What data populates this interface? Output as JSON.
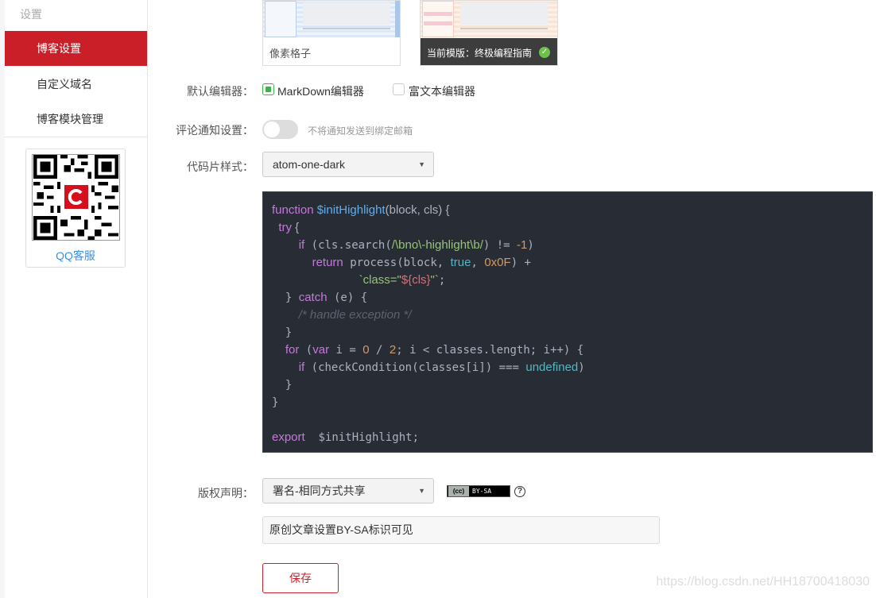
{
  "sidebar": {
    "heading": "设置",
    "items": [
      {
        "label": "博客设置",
        "active": true
      },
      {
        "label": "自定义域名",
        "active": false
      },
      {
        "label": "博客模块管理",
        "active": false
      }
    ],
    "qr": {
      "caption": "QQ客服"
    }
  },
  "templates": [
    {
      "name": "像素格子",
      "current": false
    },
    {
      "name": "当前模版：终极编程指南",
      "current": true
    }
  ],
  "form": {
    "editor": {
      "label": "默认编辑器：",
      "options": [
        {
          "label": "MarkDown编辑器",
          "checked": true
        },
        {
          "label": "富文本编辑器",
          "checked": false
        }
      ]
    },
    "comment_notify": {
      "label": "评论通知设置：",
      "enabled": false,
      "hint": "不将通知发送到绑定邮箱"
    },
    "code_style": {
      "label": "代码片样式：",
      "value": "atom-one-dark"
    },
    "copyright": {
      "label": "版权声明：",
      "value": "署名-相同方式共享",
      "badge_left": "(cc)",
      "badge_right": "BY-SA",
      "help": "?",
      "note_value": "原创文章设置BY-SA标识可见"
    },
    "save_label": "保存"
  },
  "code_preview": {
    "lines": [
      "function $initHighlight(block, cls) {",
      "  try {",
      "    if (cls.search(/\\bno\\-highlight\\b/) != -1)",
      "      return process(block, true, 0x0F) +",
      "             `class=\"${cls}\"`;",
      "  } catch (e) {",
      "    /* handle exception */",
      "  }",
      "  for (var i = 0 / 2; i < classes.length; i++) {",
      "    if (checkCondition(classes[i]) === undefined)",
      "  }",
      "}",
      "",
      "export  $initHighlight;"
    ]
  },
  "watermark": "https://blog.csdn.net/HH18700418030",
  "colors": {
    "brand_red": "#ca1e29",
    "success_green": "#3cb34a",
    "code_bg": "#282c34"
  }
}
